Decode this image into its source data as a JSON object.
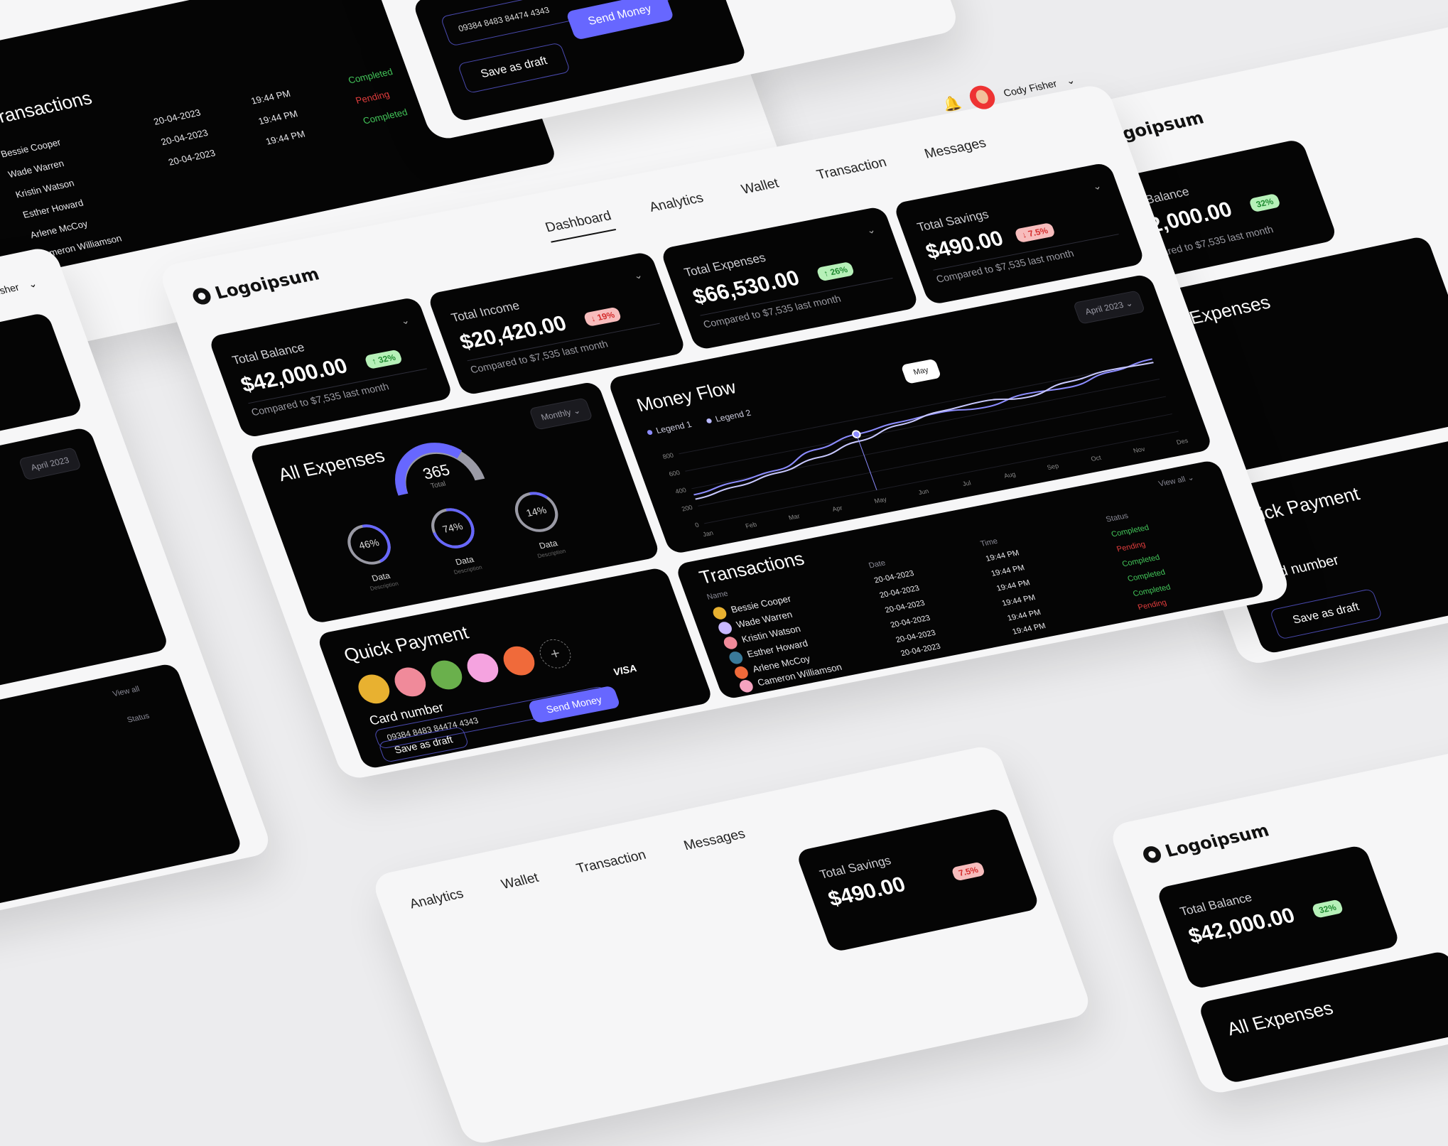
{
  "logo": "Logoipsum",
  "nav": {
    "tabs": [
      "Dashboard",
      "Analytics",
      "Wallet",
      "Transaction",
      "Messages"
    ],
    "active": "Dashboard"
  },
  "user": {
    "name": "Cody Fisher"
  },
  "stats": [
    {
      "label": "Total Balance",
      "value": "$42,000.00",
      "badge": "32%",
      "trend": "up",
      "compare": "Compared to $7,535 last month"
    },
    {
      "label": "Total Income",
      "value": "$20,420.00",
      "badge": "19%",
      "trend": "down",
      "compare": "Compared to $7,535 last month"
    },
    {
      "label": "Total Expenses",
      "value": "$66,530.00",
      "badge": "26%",
      "trend": "up",
      "compare": "Compared to $7,535 last month"
    },
    {
      "label": "Total Savings",
      "value": "$490.00",
      "badge": "7.5%",
      "trend": "down",
      "compare": "Compared to $7,535 last month"
    }
  ],
  "expenses": {
    "title": "All Expenses",
    "dropdown": "Monthly",
    "total": "365",
    "total_label": "Total",
    "rings": [
      {
        "pct": "46%",
        "label": "Data",
        "desc": "Description"
      },
      {
        "pct": "74%",
        "label": "Data",
        "desc": "Description"
      },
      {
        "pct": "14%",
        "label": "Data",
        "desc": "Description"
      }
    ]
  },
  "money_flow": {
    "title": "Money Flow",
    "dropdown": "April 2023",
    "legend": [
      "Legend 1",
      "Legend 2"
    ],
    "tooltip": "May"
  },
  "chart_data": {
    "type": "line",
    "x": [
      "Jan",
      "Feb",
      "Mar",
      "Apr",
      "May",
      "Jun",
      "Jul",
      "Aug",
      "Sep",
      "Oct",
      "Nov",
      "Des"
    ],
    "yticks": [
      0,
      200,
      400,
      600,
      800
    ],
    "ylim": [
      0,
      900
    ],
    "series": [
      {
        "name": "Legend 1",
        "values": [
          330,
          380,
          420,
          560,
          640,
          680,
          700,
          660,
          720,
          700,
          780,
          830
        ]
      },
      {
        "name": "Legend 2",
        "values": [
          280,
          330,
          390,
          470,
          560,
          650,
          710,
          730,
          680,
          760,
          800,
          790
        ]
      }
    ]
  },
  "transactions": {
    "title": "Transactions",
    "view_all": "View all",
    "columns": [
      "Name",
      "Date",
      "Time",
      "Status"
    ],
    "rows": [
      {
        "name": "Bessie Cooper",
        "date": "20-04-2023",
        "time": "19:44 PM",
        "status": "Completed"
      },
      {
        "name": "Wade Warren",
        "date": "20-04-2023",
        "time": "19:44 PM",
        "status": "Pending"
      },
      {
        "name": "Kristin Watson",
        "date": "20-04-2023",
        "time": "19:44 PM",
        "status": "Completed"
      },
      {
        "name": "Esther Howard",
        "date": "20-04-2023",
        "time": "19:44 PM",
        "status": "Completed"
      },
      {
        "name": "Arlene McCoy",
        "date": "20-04-2023",
        "time": "19:44 PM",
        "status": "Completed"
      },
      {
        "name": "Cameron Williamson",
        "date": "20-04-2023",
        "time": "19:44 PM",
        "status": "Pending"
      }
    ]
  },
  "quick_payment": {
    "title": "Quick Payment",
    "card_label": "Card number",
    "card_brand": "VISA",
    "card_number": "09384 8483 84474 4343",
    "save_label": "Save as draft",
    "send_label": "Send Money"
  },
  "colors": {
    "accent": "#6767ff",
    "completed": "#43c65a",
    "pending": "#e23d3d"
  }
}
